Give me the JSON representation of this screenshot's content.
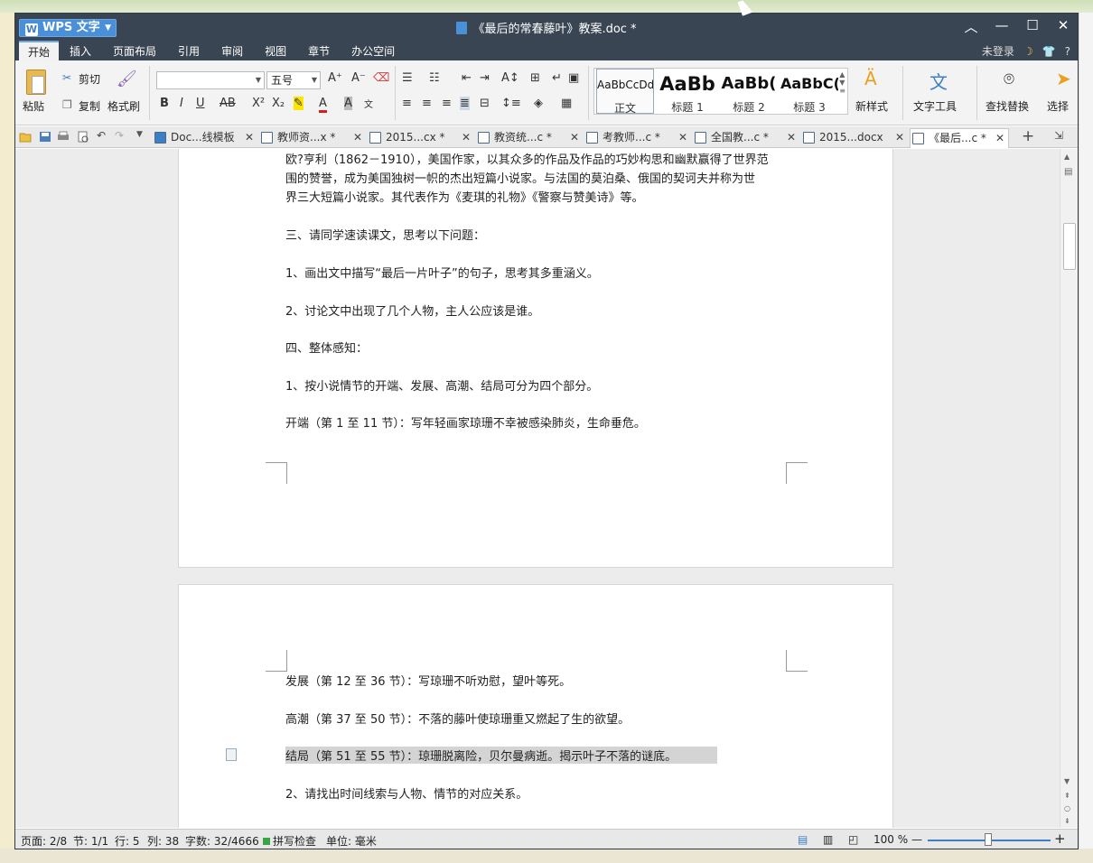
{
  "app": {
    "name": "WPS 文字",
    "title": "《最后的常春藤叶》教案.doc *"
  },
  "menu": {
    "items": [
      "开始",
      "插入",
      "页面布局",
      "引用",
      "审阅",
      "视图",
      "章节",
      "办公空间"
    ],
    "login": "未登录",
    "help": "?"
  },
  "ribbon": {
    "paste": "粘贴",
    "cut": "剪切",
    "copy": "复制",
    "format_painter": "格式刷",
    "font_name": "",
    "font_size": "五号",
    "styles": [
      {
        "preview": "AaBbCcDd",
        "name": "正文"
      },
      {
        "preview": "AaBb",
        "name": "标题 1"
      },
      {
        "preview": "AaBb(",
        "name": "标题 2"
      },
      {
        "preview": "AaBbC(",
        "name": "标题 3"
      }
    ],
    "new_style": "新样式",
    "text_tools": "文字工具",
    "find_replace": "查找替换",
    "select": "选择"
  },
  "tabs": [
    {
      "label": "Doc...线模板",
      "active": false
    },
    {
      "label": "教师资...x *",
      "active": false
    },
    {
      "label": "2015...cx *",
      "active": false
    },
    {
      "label": "教资统...c *",
      "active": false
    },
    {
      "label": "考教师...c *",
      "active": false
    },
    {
      "label": "全国教...c *",
      "active": false
    },
    {
      "label": "2015...docx",
      "active": false
    },
    {
      "label": "《最后...c *",
      "active": true
    }
  ],
  "document": {
    "page1_lines": [
      "欧?亨利（1862－1910），美国作家，以其众多的作品及作品的巧妙构思和幽默赢得了世界范",
      "围的赞誉，成为美国独树一帜的杰出短篇小说家。与法国的莫泊桑、俄国的契诃夫并称为世",
      "界三大短篇小说家。其代表作为《麦琪的礼物》《警察与赞美诗》等。",
      "三、请同学速读课文，思考以下问题：",
      "1、画出文中描写“最后一片叶子”的句子，思考其多重涵义。",
      "2、讨论文中出现了几个人物，主人公应该是谁。",
      "四、整体感知：",
      "1、按小说情节的开端、发展、高潮、结局可分为四个部分。",
      "开端（第 1 至 11 节）：写年轻画家琼珊不幸被感染肺炎，生命垂危。"
    ],
    "page2_lines": [
      "发展（第 12 至 36 节）：写琼珊不听劝慰，望叶等死。",
      "高潮（第 37 至 50 节）：不落的藤叶使琼珊重又燃起了生的欲望。",
      "结局（第 51 至 55 节）：琼珊脱离险，贝尔曼病逝。揭示叶子不落的谜底。",
      "2、请找出时间线索与人物、情节的对应关系。"
    ]
  },
  "status": {
    "page": "页面: 2/8",
    "section": "节: 1/1",
    "row": "行: 5",
    "col": "列: 38",
    "words": "字数: 32/4666",
    "spell": "拼写检查",
    "unit": "单位: 毫米",
    "zoom": "100 %",
    "zoom_level": 1.0
  }
}
